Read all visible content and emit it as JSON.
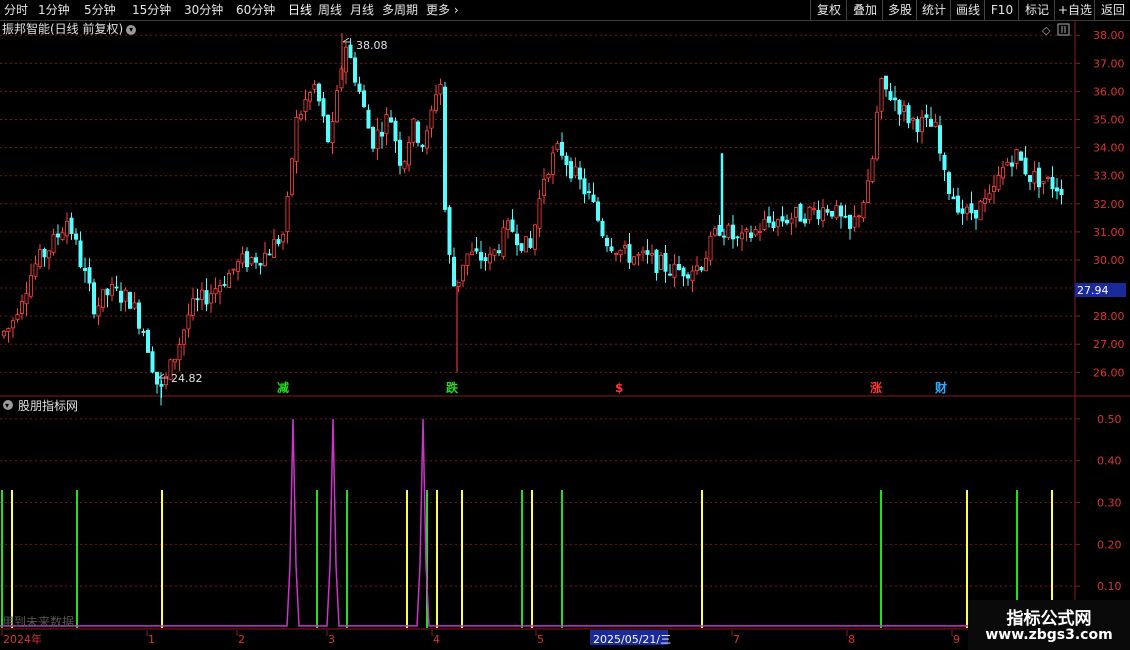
{
  "toolbar": {
    "periods": [
      "分时",
      "1分钟",
      "5分钟",
      "15分钟",
      "30分钟",
      "60分钟",
      "日线",
      "周线",
      "月线",
      "多周期",
      "更多"
    ],
    "active_period": "日线",
    "right_buttons": [
      "复权",
      "叠加",
      "多股",
      "统计",
      "画线",
      "F10",
      "标记",
      "+自选",
      "返回"
    ]
  },
  "main_panel": {
    "title": "振邦智能(日线 前复权)",
    "high_label": "38.08",
    "low_label": "24.82",
    "current_price": "27.94",
    "y_axis_labels": [
      "38.00",
      "37.00",
      "36.00",
      "35.00",
      "34.00",
      "33.00",
      "32.00",
      "31.00",
      "30.00",
      "29.00",
      "28.00",
      "27.00",
      "26.00"
    ],
    "y_range": [
      25.3,
      38.4
    ],
    "markers": [
      {
        "text": "减",
        "color": "#22dd22"
      },
      {
        "text": "跌",
        "color": "#22dd22"
      },
      {
        "text": "$",
        "color": "#ff3333"
      },
      {
        "text": "涨",
        "color": "#ff3333"
      },
      {
        "text": "财",
        "color": "#33aaff"
      }
    ]
  },
  "sub_panel": {
    "title": "股朋指标网",
    "y_axis_labels": [
      "0.50",
      "0.40",
      "0.30",
      "0.20",
      "0.10"
    ],
    "y_range": [
      0,
      0.55
    ],
    "watermark": "用到未来数据",
    "colors": {
      "green": "#22dd22",
      "yellow": "#ffff44",
      "magenta": "#cc33cc"
    }
  },
  "chart_data": {
    "type": "candlestick",
    "title": "振邦智能(日线 前复权)",
    "date_axis": [
      "2024年",
      "1",
      "2",
      "3",
      "4",
      "5",
      "2025/05/21/三",
      "7",
      "8",
      "9"
    ],
    "price_range": [
      24.82,
      38.08
    ],
    "last_price": 27.94,
    "indicator": {
      "name": "股朋指标网",
      "green_bar_value": 0.33,
      "yellow_bar_value": 0.33,
      "magenta_spikes": [
        0.5,
        0.5,
        0.5
      ]
    }
  },
  "logo": {
    "line1": "指标公式网",
    "line2": "www.zbgs3.com"
  }
}
